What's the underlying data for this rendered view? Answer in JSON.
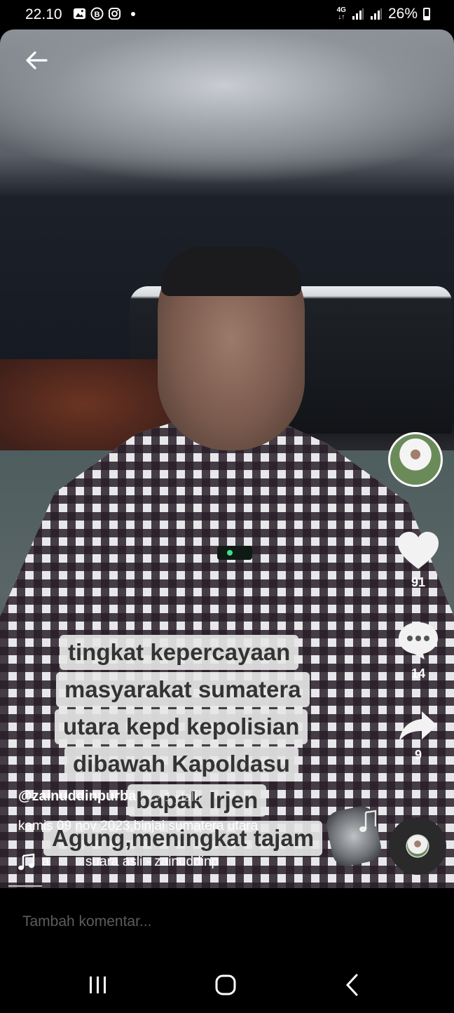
{
  "status_bar": {
    "time": "22.10",
    "network": "4G",
    "battery": "26%"
  },
  "caption": {
    "lines": [
      "tingkat kepercayaan",
      "masyarakat sumatera",
      "utara kepd kepolisian",
      "dibawah Kapoldasu",
      "bapak Irjen",
      "Agung,meningkat tajam"
    ]
  },
  "actions": {
    "likes": "91",
    "comments": "14",
    "shares": "9"
  },
  "post": {
    "username": "@zainuddinpurba",
    "time_ago": "· 1 j lalu",
    "description": "kamis 09 nov 2023,binjai sumatera utara",
    "music_prefix": "a",
    "music": "suara asli - zainuddinp"
  },
  "comment_bar": {
    "placeholder": "Tambah komentar..."
  },
  "colors": {
    "background": "#000000",
    "caption_bg": "#e6e6e6",
    "caption_text": "#333333",
    "muted_text": "#5c5c5c"
  }
}
